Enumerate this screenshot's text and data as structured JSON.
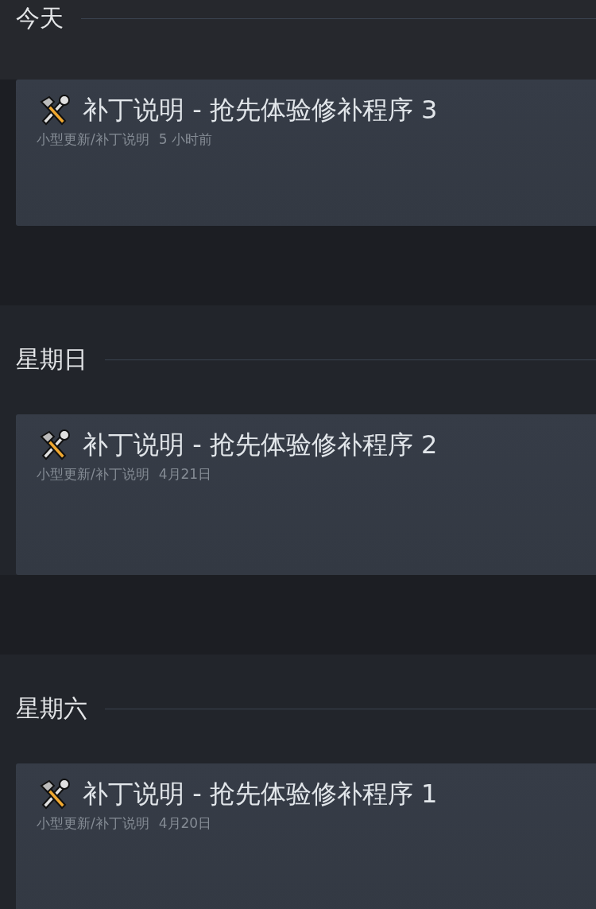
{
  "sections": [
    {
      "heading": "今天",
      "post": {
        "title": "补丁说明 - 抢先体验修补程序 3",
        "category": "小型更新/补丁说明",
        "time": "5 小时前"
      }
    },
    {
      "heading": "星期日",
      "post": {
        "title": "补丁说明 - 抢先体验修补程序 2",
        "category": "小型更新/补丁说明",
        "time": "4月21日"
      }
    },
    {
      "heading": "星期六",
      "post": {
        "title": "补丁说明 - 抢先体验修补程序 1",
        "category": "小型更新/补丁说明",
        "time": "4月20日"
      }
    }
  ]
}
